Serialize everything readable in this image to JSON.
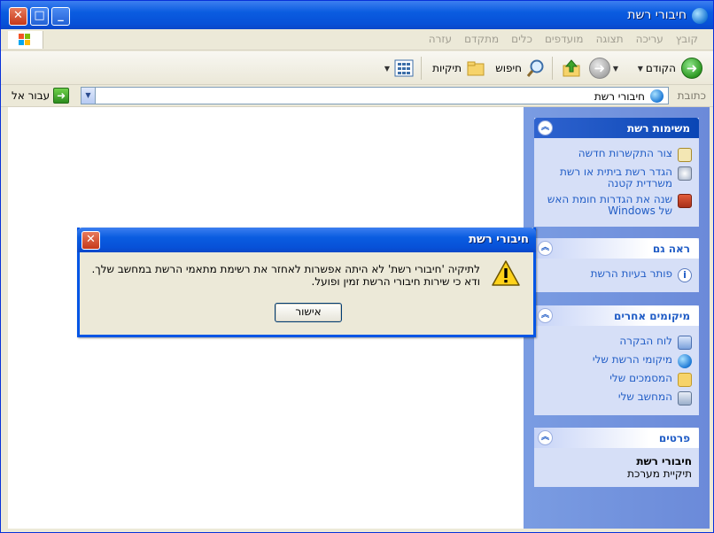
{
  "window": {
    "title": "חיבורי רשת",
    "close_glyph": "✕",
    "max_glyph": "□",
    "min_glyph": "_"
  },
  "menu": [
    "קובץ",
    "עריכה",
    "תצוגה",
    "מועדפים",
    "כלים",
    "מתקדם",
    "עזרה"
  ],
  "toolbar": {
    "back_label": "הקודם",
    "search_label": "חיפוש",
    "folders_label": "תיקיות"
  },
  "address": {
    "label": "כתובת",
    "value": "חיבורי רשת",
    "go_label": "עבור אל"
  },
  "taskpane": {
    "network_tasks": {
      "title": "משימות רשת",
      "items": [
        {
          "label": "צור התקשרות חדשה",
          "icon": "new-connection-icon"
        },
        {
          "label": "הגדר רשת ביתית או רשת משרדית קטנה",
          "icon": "home-network-icon"
        },
        {
          "label": "שנה את הגדרות חומת האש של Windows",
          "icon": "firewall-icon"
        }
      ]
    },
    "see_also": {
      "title": "ראה גם",
      "items": [
        {
          "label": "פותר בעיות הרשת",
          "icon": "info-icon"
        }
      ]
    },
    "other_places": {
      "title": "מיקומים אחרים",
      "items": [
        {
          "label": "לוח הבקרה",
          "icon": "control-panel-icon"
        },
        {
          "label": "מיקומי הרשת שלי",
          "icon": "network-places-icon"
        },
        {
          "label": "המסמכים שלי",
          "icon": "documents-icon"
        },
        {
          "label": "המחשב שלי",
          "icon": "computer-icon"
        }
      ]
    },
    "details": {
      "title": "פרטים",
      "name": "חיבורי רשת",
      "type": "תיקיית מערכת"
    }
  },
  "dialog": {
    "title": "חיבורי רשת",
    "message_line1": "לתיקיה 'חיבורי רשת' לא היתה אפשרות לאחזר את רשימת מתאמי הרשת במחשב שלך.",
    "message_line2": "ודא כי שירות חיבורי הרשת זמין ופועל.",
    "ok_label": "אישור",
    "icon": "warning-icon"
  },
  "colors": {
    "titlebar": "#0a5ce0",
    "taskpane_bg": "#6b8ad9",
    "link": "#215dc6"
  }
}
